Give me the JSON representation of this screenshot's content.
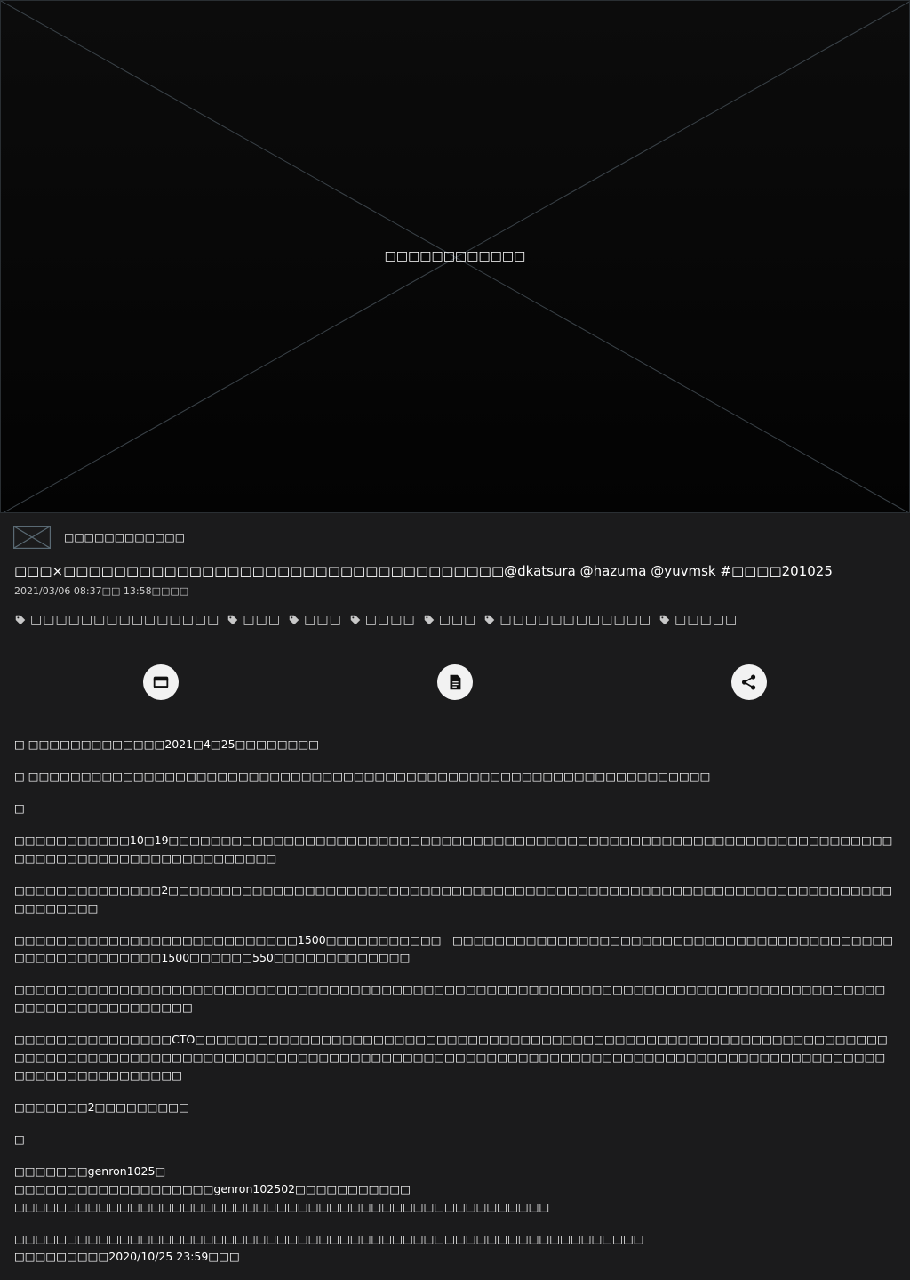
{
  "player": {
    "placeholder_text": "□□□□□□□□□□□□"
  },
  "channel": {
    "name": "□□□□□□□□□□□□"
  },
  "video": {
    "title": "□□□×□□□□□□□□□□□□□□□□□□□□□□□□□□□□□□□□□□□@dkatsura @hazuma @yuvmsk #□□□□201025",
    "date": "2021/03/06 08:37□□ 13:58□□□□"
  },
  "tags": [
    "□□□□□□□□□□□□□□□",
    "□□□",
    "□□□",
    "□□□□",
    "□□□",
    "□□□□□□□□□□□□",
    "□□□□□"
  ],
  "actions": [
    {
      "name": "payment-button",
      "icon": "credit-card-icon"
    },
    {
      "name": "document-button",
      "icon": "document-icon"
    },
    {
      "name": "share-button",
      "icon": "share-icon"
    }
  ],
  "description": [
    "□ □□□□□□□□□□□□□2021□4□25□□□□□□□□",
    "□ □□□□□□□□□□□□□□□□□□□□□□□□□□□□□□□□□□□□□□□□□□□□□□□□□□□□□□□□□□□□□□□□□",
    "□",
    "□□□□□□□□□□□10□19□□□□□□□□□□□□□□□□□□□□□□□□□□□□□□□□□□□□□□□□□□□□□□□□□□□□□□□□□□□□□□□□□□□□□□□□□□□□□□□□□□□□□□□□□□□□□□",
    "□□□□□□□□□□□□□□2□□□□□□□□□□□□□□□□□□□□□□□□□□□□□□□□□□□□□□□□□□□□□□□□□□□□□□□□□□□□□□□□□□□□□□□□□□□□□",
    "□□□□□□□□□□□□□□□□□□□□□□□□□□□1500□□□□□□□□□□□　□□□□□□□□□□□□□□□□□□□□□□□□□□□□□□□□□□□□□□□□□□□□□□□□□□□□□□□□1500□□□□□□550□□□□□□□□□□□□□",
    "□□□□□□□□□□□□□□□□□□□□□□□□□□□□□□□□□□□□□□□□□□□□□□□□□□□□□□□□□□□□□□□□□□□□□□□□□□□□□□□□□□□□□□□□□□□□□□□□□□□□",
    "□□□□□□□□□□□□□□□CTO□□□□□□□□□□□□□□□□□□□□□□□□□□□□□□□□□□□□□□□□□□□□□□□□□□□□□□□□□□□□□□□□□□□□□□□□□□□□□□□□□□□□□□□□□□□□□□□□□□□□□□□□□□□□□□□□□□□□□□□□□□□□□□□□□□□□□□□□□□□□□□□□□□□□□□□□□□□□□□□□□□□□□",
    "□□□□□□□2□□□□□□□□□",
    "□",
    "□□□□□□□genron1025□\n□□□□□□□□□□□□□□□□□□□genron102502□□□□□□□□□□□\n□□□□□□□□□□□□□□□□□□□□□□□□□□□□□□□□□□□□□□□□□□□□□□□□□□□",
    "□□□□□□□□□□□□□□□□□□□□□□□□□□□□□□□□□□□□□□□□□□□□□□□□□□□□□□□□□□□□\n□□□□□□□□□2020/10/25 23:59□□□"
  ],
  "colors": {
    "background": "#1b1b1c",
    "player_bg": "#050505",
    "action_bg": "#f2f2f2"
  }
}
